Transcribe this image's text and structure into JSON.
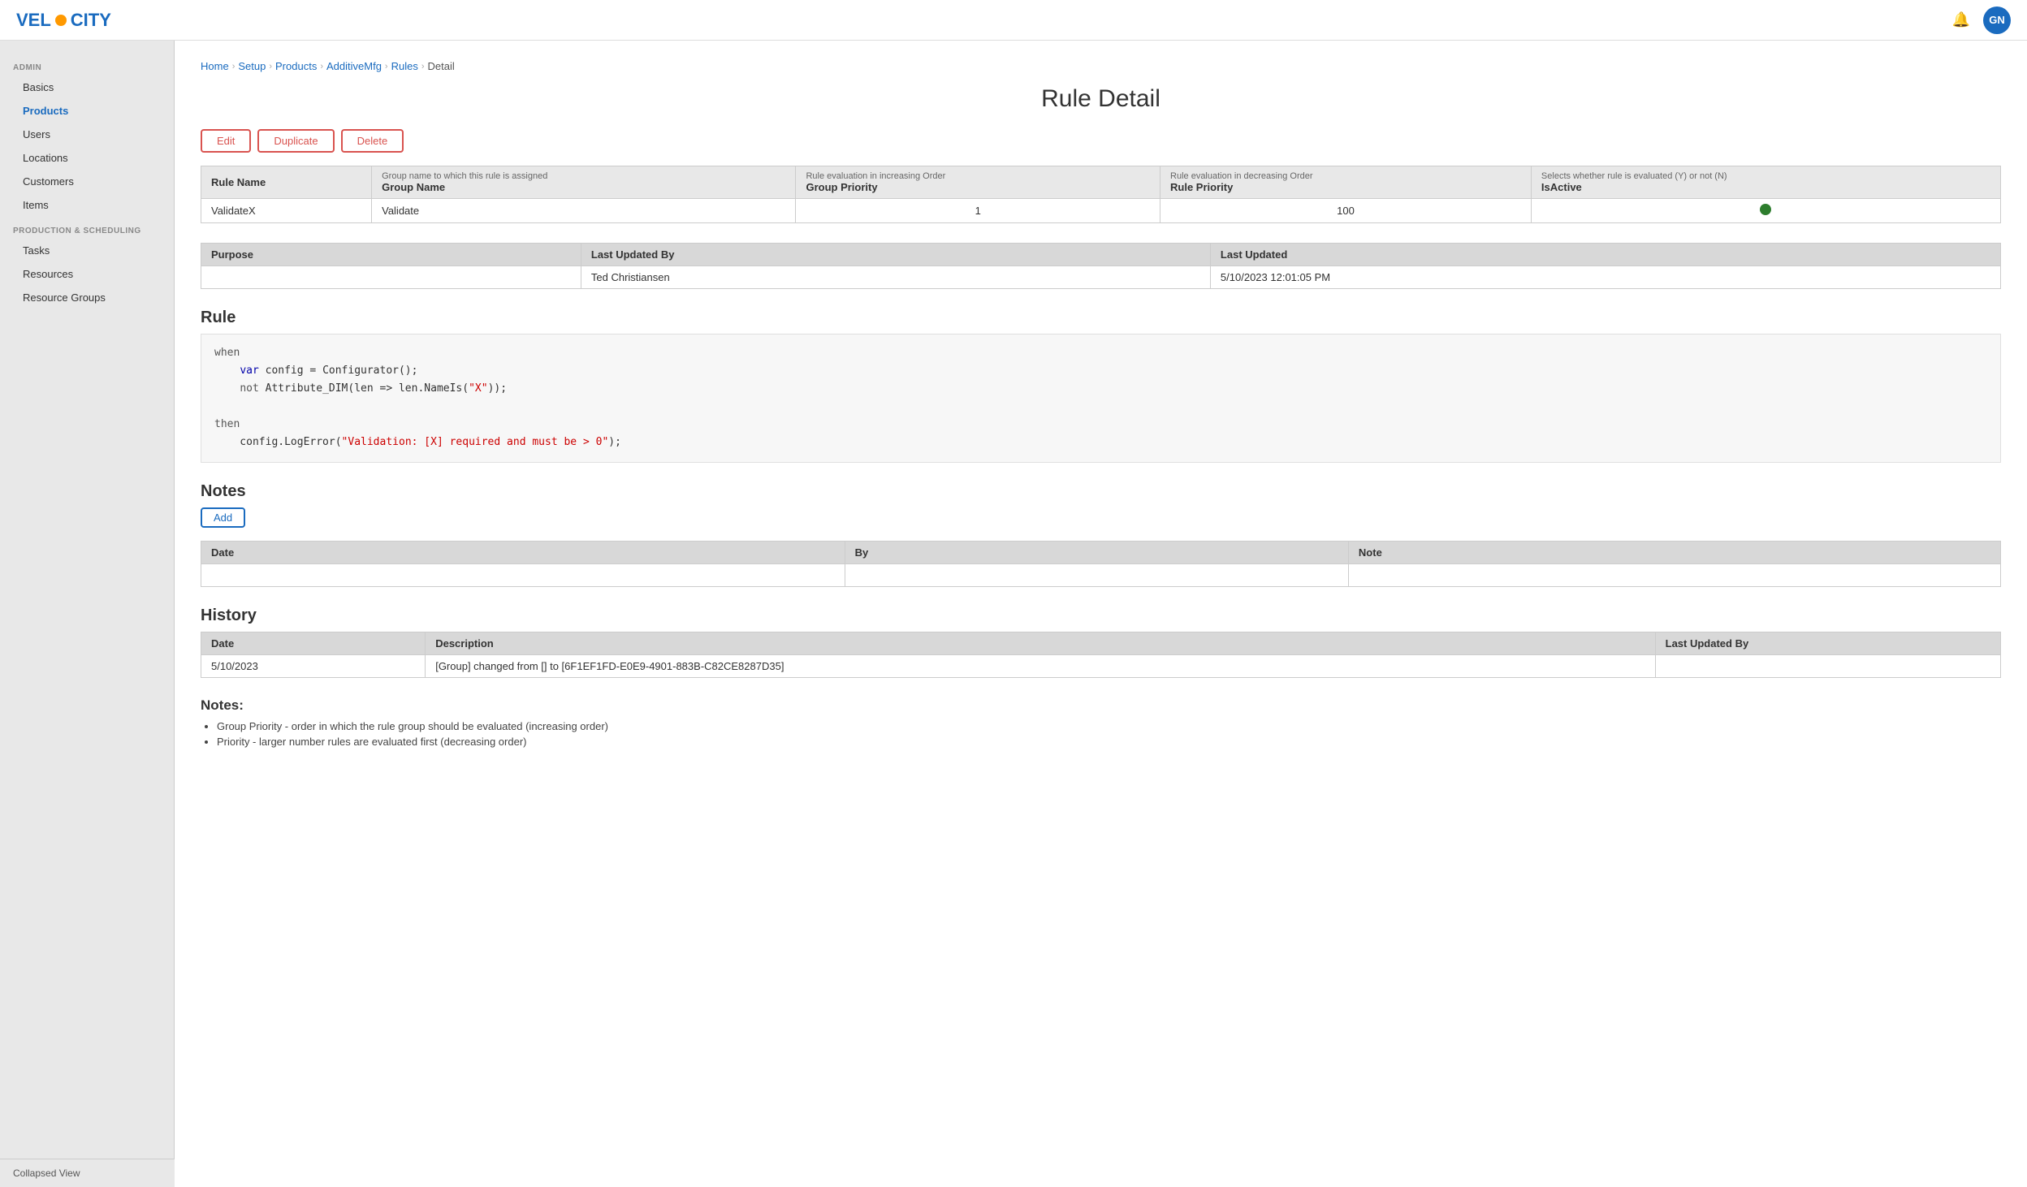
{
  "header": {
    "logo_text_1": "VEL",
    "logo_text_2": "CITY",
    "avatar_initials": "GN"
  },
  "sidebar": {
    "admin_label": "ADMIN",
    "admin_items": [
      {
        "label": "Basics",
        "key": "basics"
      },
      {
        "label": "Products",
        "key": "products"
      },
      {
        "label": "Users",
        "key": "users"
      },
      {
        "label": "Locations",
        "key": "locations"
      },
      {
        "label": "Customers",
        "key": "customers"
      },
      {
        "label": "Items",
        "key": "items"
      }
    ],
    "prod_label": "PRODUCTION & SCHEDULING",
    "prod_items": [
      {
        "label": "Tasks",
        "key": "tasks"
      },
      {
        "label": "Resources",
        "key": "resources"
      },
      {
        "label": "Resource Groups",
        "key": "resource-groups"
      }
    ],
    "collapsed_label": "Collapsed View"
  },
  "breadcrumb": {
    "items": [
      "Home",
      "Setup",
      "Products",
      "AdditiveMfg",
      "Rules",
      "Detail"
    ]
  },
  "page_title": "Rule Detail",
  "buttons": {
    "edit": "Edit",
    "duplicate": "Duplicate",
    "delete": "Delete",
    "add": "Add"
  },
  "rule_table": {
    "headers": [
      {
        "sub": "",
        "main": "Rule Name"
      },
      {
        "sub": "Group name to which this rule is assigned",
        "main": "Group Name"
      },
      {
        "sub": "Rule evaluation in increasing Order",
        "main": "Group Priority"
      },
      {
        "sub": "Rule evaluation in decreasing Order",
        "main": "Rule Priority"
      },
      {
        "sub": "Selects whether rule is evaluated (Y) or not (N)",
        "main": "IsActive"
      }
    ],
    "row": {
      "rule_name": "ValidateX",
      "group_name": "Validate",
      "group_priority": "1",
      "rule_priority": "100",
      "is_active": true
    }
  },
  "purpose_table": {
    "headers": [
      "Purpose",
      "Last Updated By",
      "Last Updated"
    ],
    "row": {
      "purpose": "",
      "last_updated_by": "Ted Christiansen",
      "last_updated": "5/10/2023 12:01:05 PM"
    }
  },
  "rule_section": {
    "title": "Rule",
    "code": {
      "line1_kw": "when",
      "line2_indent": "    ",
      "line2_kw": "var",
      "line2_rest": " config = Configurator();",
      "line3_indent": "    ",
      "line3_kw": "not",
      "line3_rest": " Attribute_DIM(len => len.NameIs(\"X\"));",
      "line4": "",
      "line5_kw": "then",
      "line6_indent": "    ",
      "line6_fn": "config.LogError(",
      "line6_str": "\"Validation: [X] required and must be > 0\"",
      "line6_end": ");"
    }
  },
  "notes_section": {
    "title": "Notes",
    "table_headers": [
      "Date",
      "By",
      "Note"
    ]
  },
  "history_section": {
    "title": "History",
    "table_headers": [
      "Date",
      "Description",
      "Last Updated By"
    ],
    "rows": [
      {
        "date": "5/10/2023",
        "description": "[Group] changed from [] to [6F1EF1FD-E0E9-4901-883B-C82CE8287D35]",
        "last_updated_by": ""
      }
    ]
  },
  "notes_bottom": {
    "title": "Notes:",
    "items": [
      "Group Priority - order in which the rule group should be evaluated (increasing order)",
      "Priority - larger number rules are evaluated first (decreasing order)"
    ]
  }
}
